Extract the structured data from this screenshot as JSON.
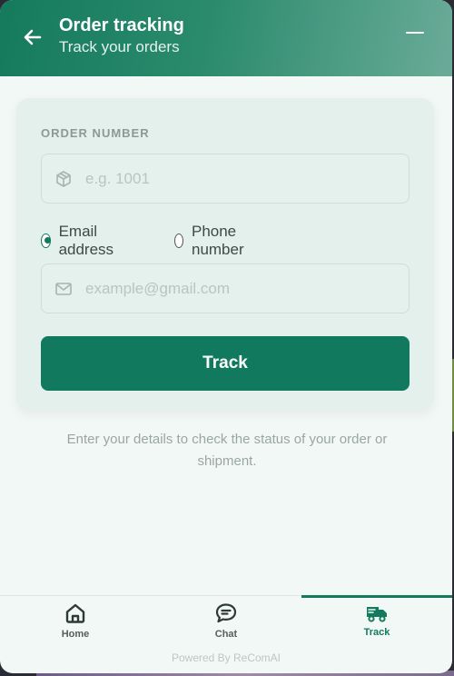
{
  "header": {
    "title": "Order tracking",
    "subtitle": "Track your orders",
    "back_icon": "arrow-left-icon",
    "minimize_icon": "minus-icon"
  },
  "form": {
    "order_label": "ORDER NUMBER",
    "order_placeholder": "e.g. 1001",
    "order_value": "",
    "order_icon": "package-icon",
    "contact_options": [
      {
        "label": "Email address",
        "selected": true
      },
      {
        "label": "Phone number",
        "selected": false
      }
    ],
    "email_placeholder": "example@gmail.com",
    "email_value": "",
    "email_icon": "mail-icon",
    "submit_label": "Track"
  },
  "helper_text": "Enter your details to check the status of your order or shipment.",
  "nav": {
    "items": [
      {
        "label": "Home",
        "icon": "home-icon",
        "active": false
      },
      {
        "label": "Chat",
        "icon": "chat-icon",
        "active": false
      },
      {
        "label": "Track",
        "icon": "truck-icon",
        "active": true
      }
    ]
  },
  "footer": {
    "powered_by": "Powered By ReComAI"
  },
  "colors": {
    "accent": "#117a5e",
    "header_gradient_start": "#157a5c",
    "header_gradient_end": "#6aab98",
    "background": "#f2f8f6",
    "card": "#e3f0eb"
  }
}
